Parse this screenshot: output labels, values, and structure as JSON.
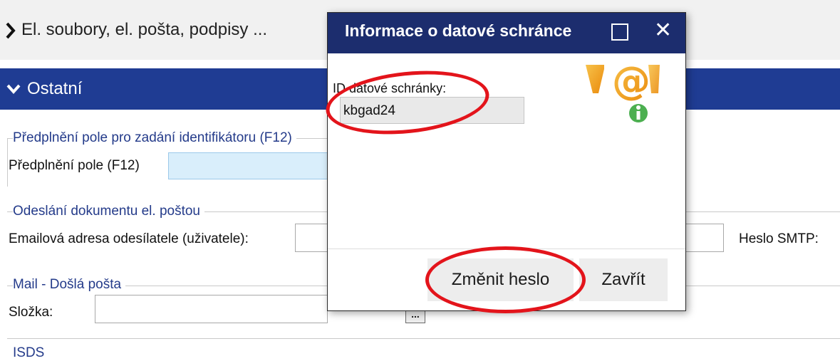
{
  "sections": {
    "top_title": "El. soubory, el. pošta, podpisy ...",
    "blue_title": "Ostatní"
  },
  "fieldsets": {
    "prefill": {
      "legend": "Předplnění pole pro zadání identifikátoru (F12)",
      "label": "Předplnění pole (F12)"
    },
    "email": {
      "legend": "Odeslání dokumentu el. poštou",
      "label": "Emailová adresa odesílatele (uživatele):",
      "smtp_label": "Heslo SMTP:"
    },
    "mail": {
      "legend": "Mail - Došlá pošta",
      "label": "Složka:",
      "browse": "..."
    },
    "isds": {
      "legend": "ISDS"
    }
  },
  "dialog": {
    "title": "Informace o datové schránce",
    "id_label": "ID datové schránky:",
    "id_value": "kbgad24",
    "change_password": "Změnit heslo",
    "close": "Zavřít",
    "icon": "databox-at-info-icon"
  },
  "colors": {
    "header_blue": "#1f3c93",
    "dialog_title_bg": "#1c2d6e",
    "legend_text": "#243b8a",
    "highlight_red": "#e3141b",
    "prefill_input_bg": "#d9eefb"
  }
}
